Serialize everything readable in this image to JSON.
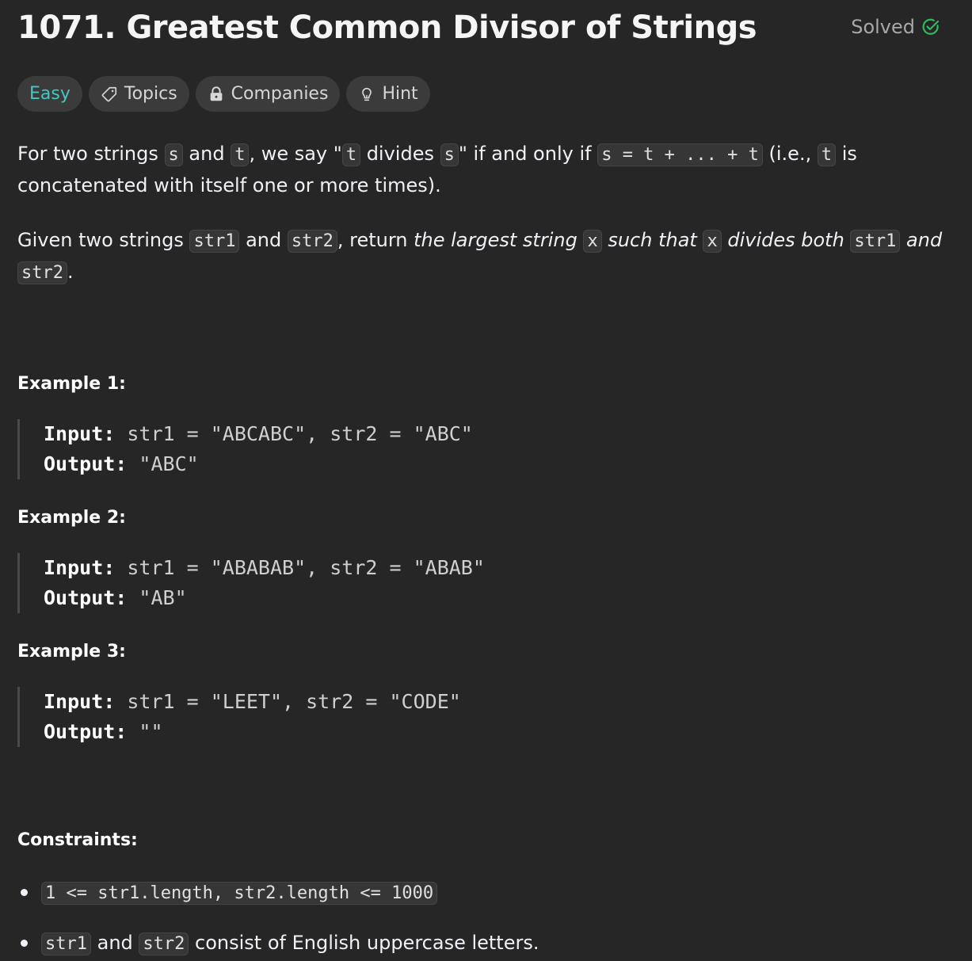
{
  "problem": {
    "title": "1071. Greatest Common Divisor of Strings",
    "status": "Solved"
  },
  "tags": {
    "difficulty": "Easy",
    "topics": "Topics",
    "companies": "Companies",
    "hint": "Hint"
  },
  "description": {
    "p1": {
      "t1": "For two strings ",
      "c1": "s",
      "t2": " and ",
      "c2": "t",
      "t3": ", we say \"",
      "c3": "t",
      "t4": " divides ",
      "c4": "s",
      "t5": "\" if and only if ",
      "c5": "s = t + ... + t",
      "t6": " (i.e., ",
      "c6": "t",
      "t7": " is concatenated with itself one or more times)."
    },
    "p2": {
      "t1": "Given two strings ",
      "c1": "str1",
      "t2": " and ",
      "c2": "str2",
      "t3": ", return ",
      "e1": "the largest string ",
      "c3": "x",
      "e2": " such that ",
      "c4": "x",
      "e3": " divides both ",
      "c5": "str1",
      "e4": " and ",
      "c6": "str2",
      "t4": "."
    }
  },
  "examples": [
    {
      "heading": "Example 1:",
      "input_label": "Input:",
      "input": " str1 = \"ABCABC\", str2 = \"ABC\"",
      "output_label": "Output:",
      "output": " \"ABC\""
    },
    {
      "heading": "Example 2:",
      "input_label": "Input:",
      "input": " str1 = \"ABABAB\", str2 = \"ABAB\"",
      "output_label": "Output:",
      "output": " \"AB\""
    },
    {
      "heading": "Example 3:",
      "input_label": "Input:",
      "input": " str1 = \"LEET\", str2 = \"CODE\"",
      "output_label": "Output:",
      "output": " \"\""
    }
  ],
  "constraints": {
    "heading": "Constraints:",
    "item1": "1 <= str1.length, str2.length <= 1000",
    "item2": {
      "c1": "str1",
      "t1": " and ",
      "c2": "str2",
      "t2": " consist of English uppercase letters."
    }
  },
  "colors": {
    "background": "#262626",
    "easy": "#46c6c2",
    "solved_check": "#2cbb5d"
  }
}
